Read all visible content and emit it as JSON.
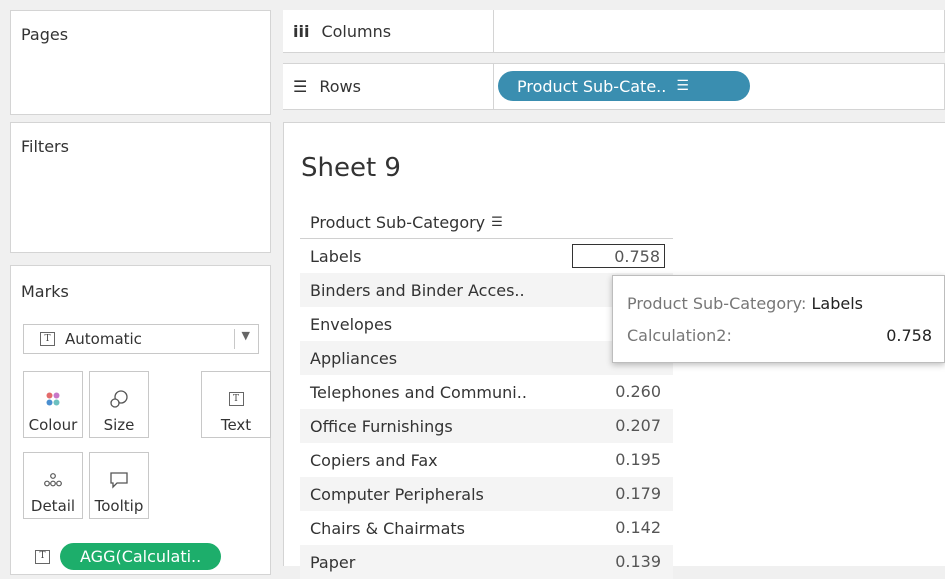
{
  "left": {
    "pages_title": "Pages",
    "filters_title": "Filters",
    "marks": {
      "title": "Marks",
      "mark_type": "Automatic",
      "mark_type_icon": "text-icon",
      "buttons": {
        "colour": "Colour",
        "size": "Size",
        "text": "Text",
        "detail": "Detail",
        "tooltip": "Tooltip"
      },
      "pill": "AGG(Calculati.."
    }
  },
  "shelves": {
    "columns_label": "Columns",
    "rows_label": "Rows",
    "rows_pill": "Product Sub-Cate.."
  },
  "sheet": {
    "title": "Sheet 9",
    "header": "Product Sub-Category",
    "rows": [
      {
        "name": "Labels",
        "value": "0.758"
      },
      {
        "name": "Binders and Binder Acces..",
        "value": ""
      },
      {
        "name": "Envelopes",
        "value": ""
      },
      {
        "name": "Appliances",
        "value": ""
      },
      {
        "name": "Telephones and Communi..",
        "value": "0.260"
      },
      {
        "name": "Office Furnishings",
        "value": "0.207"
      },
      {
        "name": "Copiers and Fax",
        "value": "0.195"
      },
      {
        "name": "Computer Peripherals",
        "value": "0.179"
      },
      {
        "name": "Chairs & Chairmats",
        "value": "0.142"
      },
      {
        "name": "Paper",
        "value": "0.139"
      }
    ]
  },
  "tooltip": {
    "line1_key": "Product Sub-Category:",
    "line1_value": "Labels",
    "line2_key": "Calculation2:",
    "line2_value": "0.758"
  },
  "colors": {
    "rows_pill": "#3a8eb0",
    "measure_pill": "#1dae6b"
  }
}
